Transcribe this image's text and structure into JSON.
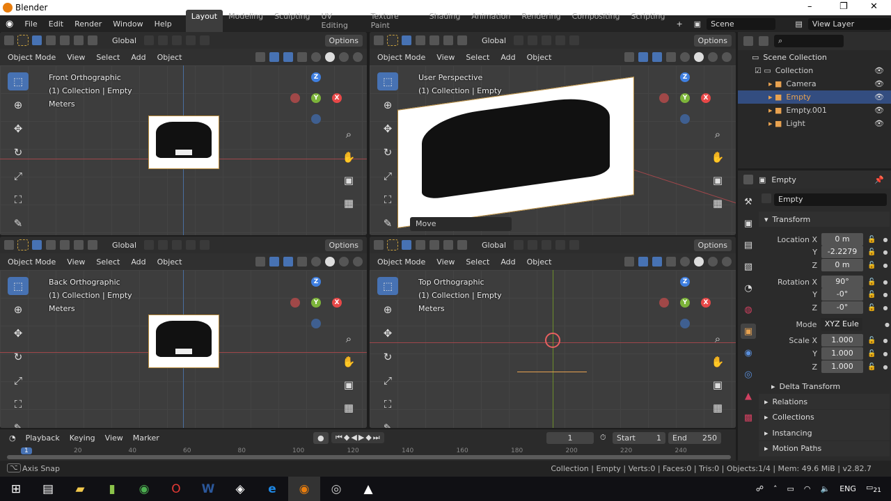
{
  "titlebar": {
    "title": "Blender",
    "controls": [
      "–",
      "❐",
      "✕"
    ]
  },
  "menu": [
    "File",
    "Edit",
    "Render",
    "Window",
    "Help"
  ],
  "workspaces": [
    "Layout",
    "Modeling",
    "Sculpting",
    "UV Editing",
    "Texture Paint",
    "Shading",
    "Animation",
    "Rendering",
    "Compositing",
    "Scripting"
  ],
  "scene": "Scene",
  "view_layer": "View Layer",
  "viewport_header": {
    "transform": "Global",
    "options": "Options",
    "mode": "Object Mode",
    "menus": [
      "View",
      "Select",
      "Add",
      "Object"
    ]
  },
  "viewports": [
    {
      "view": "Front Orthographic",
      "collection": "(1) Collection | Empty",
      "units": "Meters"
    },
    {
      "view": "User Perspective",
      "collection": "(1) Collection | Empty",
      "units": "",
      "last_op": "Move"
    },
    {
      "view": "Back Orthographic",
      "collection": "(1) Collection | Empty",
      "units": "Meters"
    },
    {
      "view": "Top Orthographic",
      "collection": "(1) Collection | Empty",
      "units": "Meters"
    }
  ],
  "outliner": {
    "root": "Scene Collection",
    "items": [
      {
        "label": "Collection",
        "depth": 1,
        "color": "#ccc",
        "selected": false
      },
      {
        "label": "Camera",
        "depth": 2,
        "color": "#ccc",
        "selected": false
      },
      {
        "label": "Empty",
        "depth": 2,
        "color": "#e8a250",
        "selected": true
      },
      {
        "label": "Empty.001",
        "depth": 2,
        "color": "#ccc",
        "selected": false
      },
      {
        "label": "Light",
        "depth": 2,
        "color": "#ccc",
        "selected": false
      }
    ]
  },
  "properties": {
    "header": "Empty",
    "object_name": "Empty",
    "transform_label": "Transform",
    "rows": [
      {
        "label": "Location X",
        "value": "0 m"
      },
      {
        "label": "Y",
        "value": "-2.2279"
      },
      {
        "label": "Z",
        "value": "0 m"
      },
      {
        "label": "Rotation X",
        "value": "90°"
      },
      {
        "label": "Y",
        "value": "-0°"
      },
      {
        "label": "Z",
        "value": "-0°"
      },
      {
        "label": "Mode",
        "value": "XYZ Eule ⌄"
      },
      {
        "label": "Scale X",
        "value": "1.000"
      },
      {
        "label": "Y",
        "value": "1.000"
      },
      {
        "label": "Z",
        "value": "1.000"
      }
    ],
    "delta": "Delta Transform",
    "sections": [
      "Relations",
      "Collections",
      "Instancing",
      "Motion Paths"
    ]
  },
  "timeline": {
    "menus": [
      "Playback",
      "Keying",
      "View",
      "Marker"
    ],
    "current_frame": "1",
    "start_label": "Start",
    "start": "1",
    "end_label": "End",
    "end": "250",
    "ticks": [
      "20",
      "40",
      "60",
      "80",
      "100",
      "120",
      "140",
      "160",
      "180",
      "200",
      "220",
      "240"
    ],
    "marker": "1"
  },
  "status": {
    "left": "Axis Snap",
    "right": "Collection | Empty | Verts:0 | Faces:0 | Tris:0 | Objects:1/4 | Mem: 49.6 MiB | v2.82.7"
  },
  "taskbar": {
    "lang": "ENG",
    "notifications": "21"
  }
}
